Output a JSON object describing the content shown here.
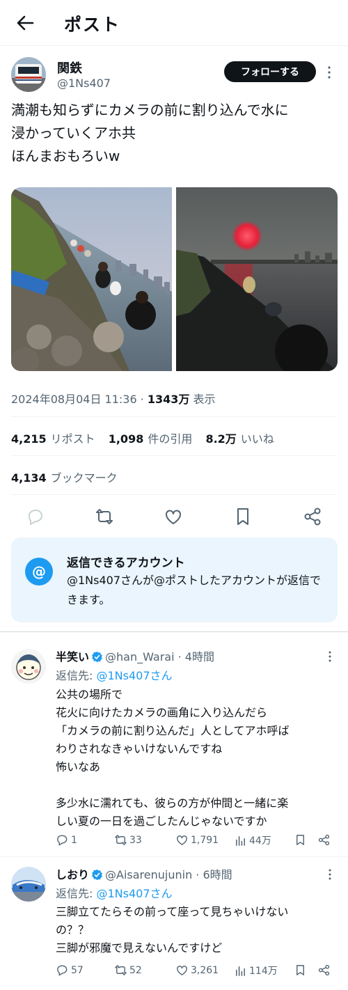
{
  "header": {
    "title": "ポスト"
  },
  "post": {
    "author_name": "関鉄",
    "author_handle": "@1Ns407",
    "follow_label": "フォローする",
    "text_lines": [
      "満潮も知らずにカメラの前に割り込んで水に",
      "浸かっていくアホ共",
      "ほんまおもろいw"
    ],
    "timestamp": "2024年08月04日 11:36",
    "views_count": "1343万",
    "views_label": "表示",
    "reposts_count": "4,215",
    "reposts_label": "リポスト",
    "quotes_count": "1,098",
    "quotes_label": "件の引用",
    "likes_count": "8.2万",
    "likes_label": "いいね",
    "bookmarks_count": "4,134",
    "bookmarks_label": "ブックマーク"
  },
  "reply_restriction": {
    "title": "返信できるアカウント",
    "text": "@1Ns407さんが@ポストしたアカウントが返信できます。"
  },
  "replies": [
    {
      "name": "半笑い",
      "handle": "@han_Warai",
      "time": "4時間",
      "reply_to_label": "返信先: ",
      "reply_to_mention": "@1Ns407さん",
      "body_lines": [
        "公共の場所で",
        "花火に向けたカメラの画角に入り込んだら",
        "「カメラの前に割り込んだ」人としてアホ呼ば",
        "わりされなきゃいけないんですね",
        "怖いなあ",
        "",
        "多少水に濡れても、彼らの方が仲間と一緒に楽",
        "しい夏の一日を過ごしたんじゃないですか"
      ],
      "replies": "1",
      "reposts": "33",
      "likes": "1,791",
      "views": "44万"
    },
    {
      "name": "しおり",
      "handle": "@Aisarenujunin",
      "time": "6時間",
      "reply_to_label": "返信先: ",
      "reply_to_mention": "@1Ns407さん",
      "body_lines": [
        "三脚立てたらその前って座って見ちゃいけない",
        "の？？",
        "三脚が邪魔で見えないんですけど"
      ],
      "replies": "57",
      "reposts": "52",
      "likes": "3,261",
      "views": "114万"
    }
  ],
  "colors": {
    "accent": "#1d9bf0",
    "text": "#0f1419",
    "secondary": "#536471",
    "reply_box_bg": "#eaf5fd"
  },
  "icons": [
    "back-arrow-icon",
    "more-icon",
    "reply-icon",
    "repost-icon",
    "like-icon",
    "bookmark-icon",
    "share-icon",
    "at-icon",
    "verified-icon",
    "views-icon"
  ]
}
